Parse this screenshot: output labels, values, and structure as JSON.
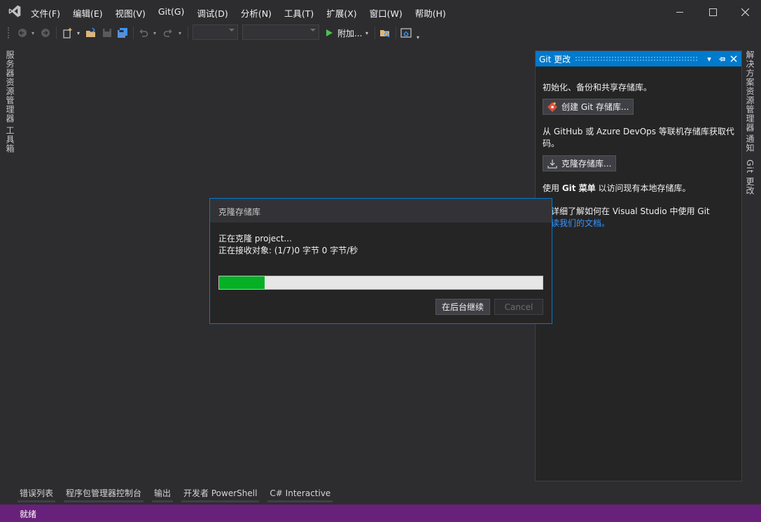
{
  "menu": {
    "items": [
      "文件(F)",
      "编辑(E)",
      "视图(V)",
      "Git(G)",
      "调试(D)",
      "分析(N)",
      "工具(T)",
      "扩展(X)",
      "窗口(W)",
      "帮助(H)"
    ]
  },
  "toolbar": {
    "attach_label": "附加..."
  },
  "left_tabs": {
    "server_explorer": "服务器资源管理器",
    "toolbox": "工具箱"
  },
  "right_tabs": {
    "solution_explorer": "解决方案资源管理器",
    "notifications": "通知",
    "git_changes": "Git 更改"
  },
  "git_panel": {
    "title": "Git 更改",
    "intro": "初始化、备份和共享存储库。",
    "create_button": "创建 Git 存储库...",
    "remote_text_1": "从 GitHub 或 Azure DevOps 等联机存储库获取代",
    "remote_text_2": "码。",
    "clone_button": "克隆存储库...",
    "use_prefix": "使用 ",
    "use_bold": "Git 菜单",
    "use_suffix": " 以访问现有本地存储库。",
    "learn_text": "要详细了解如何在 Visual Studio 中使用 Git",
    "learn_link": "阅读我们的文档。"
  },
  "dialog": {
    "title": "克隆存储库",
    "line1": "正在克隆 project...",
    "line2": "正在接收对象: (1/7)0 字节 0 字节/秒",
    "progress": 0.14,
    "background_button": "在后台继续",
    "cancel_button": "Cancel"
  },
  "bottom_tabs": [
    "错误列表",
    "程序包管理器控制台",
    "输出",
    "开发者 PowerShell",
    "C# Interactive"
  ],
  "status": {
    "text": "就绪"
  },
  "colors": {
    "accent": "#007acc",
    "statusbar": "#68217a",
    "progress": "#06b025",
    "link": "#3794ff"
  }
}
